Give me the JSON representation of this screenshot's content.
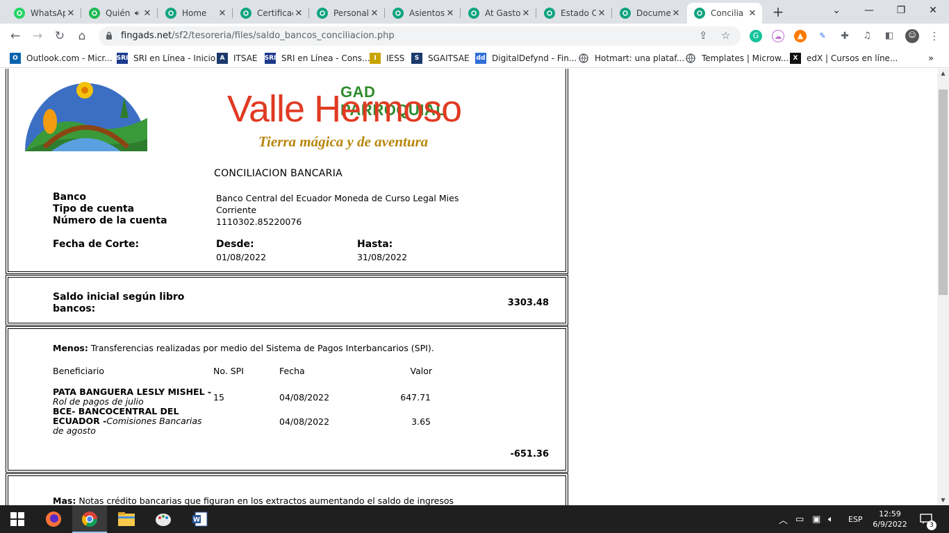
{
  "browser": {
    "tabs": [
      {
        "title": "WhatsApp",
        "icon": "whatsapp-icon",
        "color": "#25d366",
        "active": false
      },
      {
        "title": "Quién",
        "icon": "spotify-icon",
        "color": "#1db954",
        "active": false,
        "audio": true
      },
      {
        "title": "Home",
        "icon": "openai-icon",
        "color": "#10a37f",
        "active": false
      },
      {
        "title": "Certificac",
        "icon": "openai-icon",
        "color": "#10a37f",
        "active": false
      },
      {
        "title": "Personal",
        "icon": "openai-icon",
        "color": "#10a37f",
        "active": false
      },
      {
        "title": "Asientos",
        "icon": "openai-icon",
        "color": "#10a37f",
        "active": false
      },
      {
        "title": "At Gasto",
        "icon": "openai-icon",
        "color": "#10a37f",
        "active": false
      },
      {
        "title": "Estado C",
        "icon": "openai-icon",
        "color": "#10a37f",
        "active": false
      },
      {
        "title": "Docume",
        "icon": "openai-icon",
        "color": "#10a37f",
        "active": false
      },
      {
        "title": "Concilia",
        "icon": "openai-icon",
        "color": "#10a37f",
        "active": true
      }
    ],
    "address": {
      "domain": "fingads.net",
      "path": "/sf2/tesoreria/files/saldo_bancos_conciliacion.php"
    },
    "bookmarks": [
      {
        "label": "Outlook.com - Micr...",
        "icon": "outlook-icon",
        "color": "#0a64ad",
        "glyph": "O"
      },
      {
        "label": "SRI en Línea - Inicio",
        "icon": "sri-icon",
        "color": "#1b3a8c",
        "glyph": "SRI"
      },
      {
        "label": "ITSAE",
        "icon": "itsae-icon",
        "color": "#1b3a6b",
        "glyph": "A"
      },
      {
        "label": "SRI en Línea - Cons...",
        "icon": "sri-icon",
        "color": "#1b3a8c",
        "glyph": "SRI"
      },
      {
        "label": "IESS",
        "icon": "iess-icon",
        "color": "#c8a400",
        "glyph": "I"
      },
      {
        "label": "SGAITSAE",
        "icon": "sgaitsae-icon",
        "color": "#1b3a6b",
        "glyph": "S"
      },
      {
        "label": "DigitalDefynd - Fin...",
        "icon": "digitaldefynd-icon",
        "color": "#2f6fd6",
        "glyph": "dd"
      },
      {
        "label": "Hotmart: una plataf...",
        "icon": "globe-icon",
        "color": "#5f6368",
        "glyph": ""
      },
      {
        "label": "Templates | Microw...",
        "icon": "globe-icon",
        "color": "#5f6368",
        "glyph": ""
      },
      {
        "label": "edX | Cursos en líne...",
        "icon": "edx-icon",
        "color": "#111111",
        "glyph": "X"
      }
    ]
  },
  "doc": {
    "logo_name": "GAD PARROQUIAL",
    "logo_title": "Valle Hermoso",
    "logo_slogan": "Tierra mágica y de aventura",
    "title": "CONCILIACION BANCARIA",
    "banco_label": "Banco",
    "banco_value": "Banco Central del Ecuador Moneda de Curso Legal Mies",
    "tipo_label": "Tipo de cuenta",
    "tipo_value": "Corriente",
    "numero_label": "Número de la cuenta",
    "numero_value": "1110302.85220076",
    "fecha_label": "Fecha de Corte:",
    "desde_label": "Desde:",
    "desde_value": "01/08/2022",
    "hasta_label": "Hasta:",
    "hasta_value": "31/08/2022",
    "saldo_label": "Saldo inicial según libro bancos:",
    "saldo_value": "3303.48",
    "menos_label": "Menos:",
    "menos_text": "Transferencias realizadas por medio del Sistema de Pagos Interbancarios (SPI).",
    "headers": {
      "beneficiario": "Beneficiario",
      "spi": "No. SPI",
      "fecha": "Fecha",
      "valor": "Valor"
    },
    "rows": [
      {
        "name": "PATA BANGUERA LESLY MISHEL -",
        "desc": "Rol de pagos de julio",
        "spi": "15",
        "fecha": "04/08/2022",
        "valor": "647.71"
      },
      {
        "name": "BCE- BANCOCENTRAL DEL ECUADOR -",
        "desc": "Comisiones Bancarias de agosto",
        "spi": "",
        "fecha": "04/08/2022",
        "valor": "3.65"
      }
    ],
    "menos_total": "-651.36",
    "mas_label": "Mas:",
    "mas_text": "Notas crédito bancarias que figuran en los extractos aumentando el saldo de ingresos"
  },
  "taskbar": {
    "language": "ESP",
    "time": "12:59",
    "date": "6/9/2022",
    "notifications": "3"
  },
  "colors": {
    "logo_red": "#e03a22",
    "logo_gold": "#b8860b",
    "logo_green": "#2e8b2e"
  }
}
